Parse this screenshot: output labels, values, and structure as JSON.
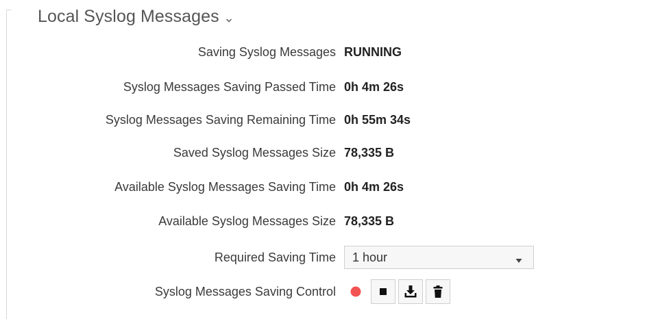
{
  "section": {
    "title": "Local Syslog Messages"
  },
  "status": [
    {
      "label": "Saving Syslog Messages",
      "value": "RUNNING"
    },
    {
      "label": "Syslog Messages Saving Passed Time",
      "value": "0h 4m 26s"
    },
    {
      "label": "Syslog Messages Saving Remaining Time",
      "value": "0h 55m 34s"
    },
    {
      "label": "Saved Syslog Messages Size",
      "value": "78,335 B"
    },
    {
      "label": "Available Syslog Messages Saving Time",
      "value": "0h 4m 26s"
    },
    {
      "label": "Available Syslog Messages Size",
      "value": "78,335 B"
    }
  ],
  "required_time": {
    "label": "Required Saving Time",
    "selected": "1 hour"
  },
  "control": {
    "label": "Syslog Messages Saving Control",
    "buttons": [
      {
        "icon": "record-icon",
        "color": "#f25454"
      },
      {
        "icon": "stop-icon"
      },
      {
        "icon": "download-icon"
      },
      {
        "icon": "trash-icon"
      }
    ]
  }
}
